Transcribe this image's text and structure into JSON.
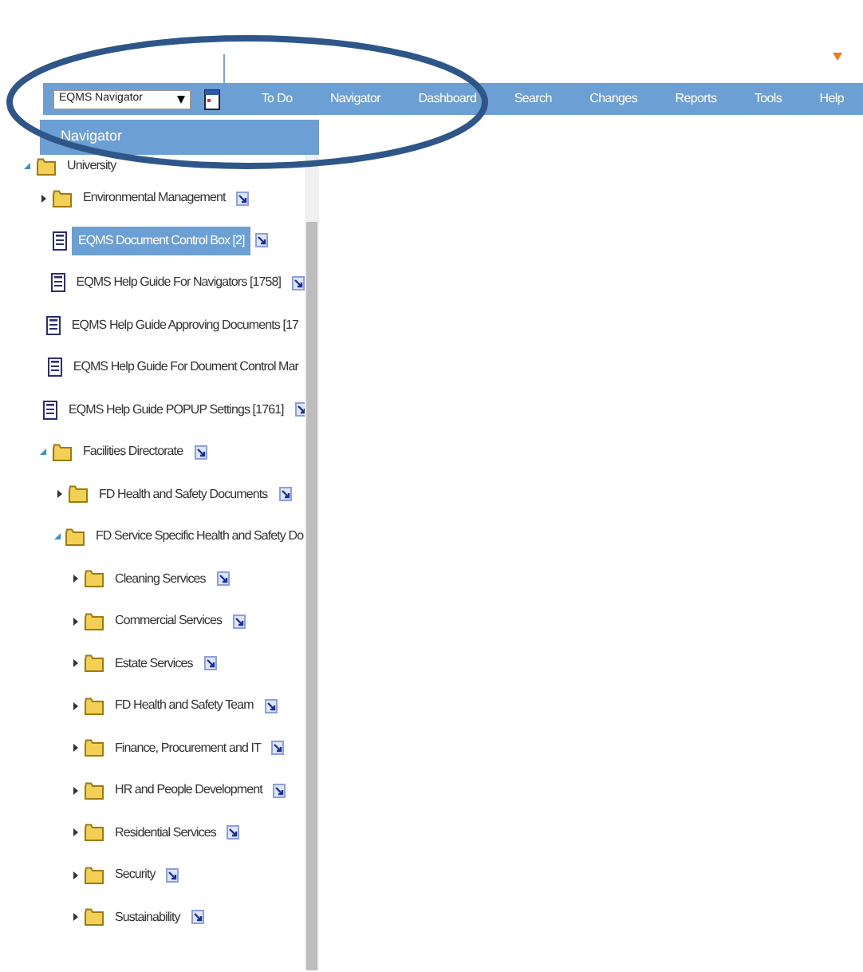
{
  "toolbar": {
    "navigator_select": {
      "value": "EQMS Navigator"
    },
    "menu": [
      {
        "label": "To Do"
      },
      {
        "label": "Navigator"
      },
      {
        "label": "Dashboard"
      },
      {
        "label": "Search"
      },
      {
        "label": "Changes"
      },
      {
        "label": "Reports"
      },
      {
        "label": "Tools"
      },
      {
        "label": "Help"
      }
    ]
  },
  "panel": {
    "title": "Navigator"
  },
  "tree": [
    {
      "kind": "folder",
      "label": "University",
      "expanded": true,
      "selected": false,
      "children": [
        {
          "kind": "folder",
          "label": "Environmental Management",
          "expanded": false,
          "selected": false,
          "shortcut": true
        },
        {
          "kind": "document",
          "label": "EQMS Document Control Box [2]",
          "selected": true,
          "shortcut": true
        },
        {
          "kind": "document",
          "label": "EQMS Help Guide For Navigators [1758]",
          "selected": false,
          "shortcut": true
        },
        {
          "kind": "document",
          "label": "EQMS Help Guide Approving Documents [17",
          "selected": false,
          "shortcut": false
        },
        {
          "kind": "document",
          "label": "EQMS Help Guide For Doument Control Mar",
          "selected": false,
          "shortcut": false
        },
        {
          "kind": "document",
          "label": "EQMS Help Guide POPUP Settings [1761]",
          "selected": false,
          "shortcut": true
        },
        {
          "kind": "folder",
          "label": "Facilities Directorate",
          "expanded": true,
          "selected": false,
          "shortcut": true,
          "children": [
            {
              "kind": "folder",
              "label": "FD Health and Safety Documents",
              "expanded": false,
              "selected": false,
              "shortcut": true
            },
            {
              "kind": "folder",
              "label": "FD Service Specific Health and Safety Do",
              "expanded": true,
              "selected": false,
              "shortcut": false,
              "children": [
                {
                  "kind": "folder",
                  "label": "Cleaning Services",
                  "expanded": false,
                  "selected": false,
                  "shortcut": true
                },
                {
                  "kind": "folder",
                  "label": "Commercial Services",
                  "expanded": false,
                  "selected": false,
                  "shortcut": true
                },
                {
                  "kind": "folder",
                  "label": "Estate Services",
                  "expanded": false,
                  "selected": false,
                  "shortcut": true
                },
                {
                  "kind": "folder",
                  "label": "FD Health and Safety Team",
                  "expanded": false,
                  "selected": false,
                  "shortcut": true
                },
                {
                  "kind": "folder",
                  "label": "Finance, Procurement and IT",
                  "expanded": false,
                  "selected": false,
                  "shortcut": true
                },
                {
                  "kind": "folder",
                  "label": "HR and People Development",
                  "expanded": false,
                  "selected": false,
                  "shortcut": true
                },
                {
                  "kind": "folder",
                  "label": "Residential Services",
                  "expanded": false,
                  "selected": false,
                  "shortcut": true
                },
                {
                  "kind": "folder",
                  "label": "Security",
                  "expanded": false,
                  "selected": false,
                  "shortcut": true
                },
                {
                  "kind": "folder",
                  "label": "Sustainability",
                  "expanded": false,
                  "selected": false,
                  "shortcut": true
                }
              ]
            }
          ]
        }
      ]
    }
  ]
}
